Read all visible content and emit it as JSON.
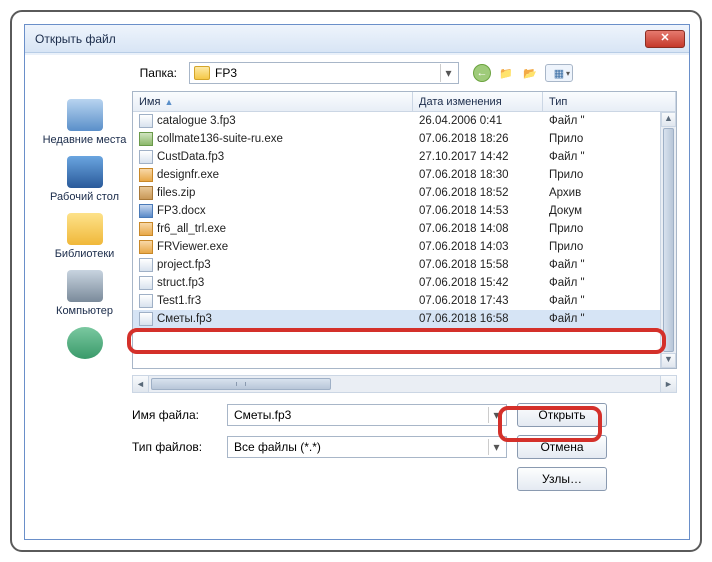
{
  "dialog": {
    "title": "Открыть файл",
    "close": "✕"
  },
  "folder": {
    "label": "Папка:",
    "value": "FP3"
  },
  "toolbar": {
    "back": "←",
    "up": "📁",
    "new": "📂",
    "view": "▦"
  },
  "places": [
    {
      "label": "Недавние места",
      "iconClass": "pi-recent"
    },
    {
      "label": "Рабочий стол",
      "iconClass": "pi-desktop"
    },
    {
      "label": "Библиотеки",
      "iconClass": "pi-lib"
    },
    {
      "label": "Компьютер",
      "iconClass": "pi-comp"
    },
    {
      "label": "",
      "iconClass": "pi-net"
    }
  ],
  "columns": {
    "name": "Имя",
    "date": "Дата изменения",
    "type": "Тип"
  },
  "files": [
    {
      "icon": "fi-fp3",
      "name": "catalogue 3.fp3",
      "date": "26.04.2006 0:41",
      "type": "Файл \""
    },
    {
      "icon": "fi-exe",
      "name": "collmate136-suite-ru.exe",
      "date": "07.06.2018 18:26",
      "type": "Прило"
    },
    {
      "icon": "fi-fp3",
      "name": "CustData.fp3",
      "date": "27.10.2017 14:42",
      "type": "Файл \""
    },
    {
      "icon": "fi-exe2",
      "name": "designfr.exe",
      "date": "07.06.2018 18:30",
      "type": "Прило"
    },
    {
      "icon": "fi-zip",
      "name": "files.zip",
      "date": "07.06.2018 18:52",
      "type": "Архив"
    },
    {
      "icon": "fi-doc",
      "name": "FP3.docx",
      "date": "07.06.2018 14:53",
      "type": "Докум"
    },
    {
      "icon": "fi-exe2",
      "name": "fr6_all_trl.exe",
      "date": "07.06.2018 14:08",
      "type": "Прило"
    },
    {
      "icon": "fi-exe2",
      "name": "FRViewer.exe",
      "date": "07.06.2018 14:03",
      "type": "Прило"
    },
    {
      "icon": "fi-fp3",
      "name": "project.fp3",
      "date": "07.06.2018 15:58",
      "type": "Файл \""
    },
    {
      "icon": "fi-fp3",
      "name": "struct.fp3",
      "date": "07.06.2018 15:42",
      "type": "Файл \""
    },
    {
      "icon": "fi-fp3",
      "name": "Test1.fr3",
      "date": "07.06.2018 17:43",
      "type": "Файл \""
    },
    {
      "icon": "fi-fp3",
      "name": "Сметы.fp3",
      "date": "07.06.2018 16:58",
      "type": "Файл \"",
      "selected": true
    }
  ],
  "fields": {
    "filename_label": "Имя файла:",
    "filename_value": "Сметы.fp3",
    "filetype_label": "Тип файлов:",
    "filetype_value": "Все файлы (*.*)"
  },
  "buttons": {
    "open": "Открыть",
    "cancel": "Отмена",
    "nodes": "Узлы…"
  }
}
